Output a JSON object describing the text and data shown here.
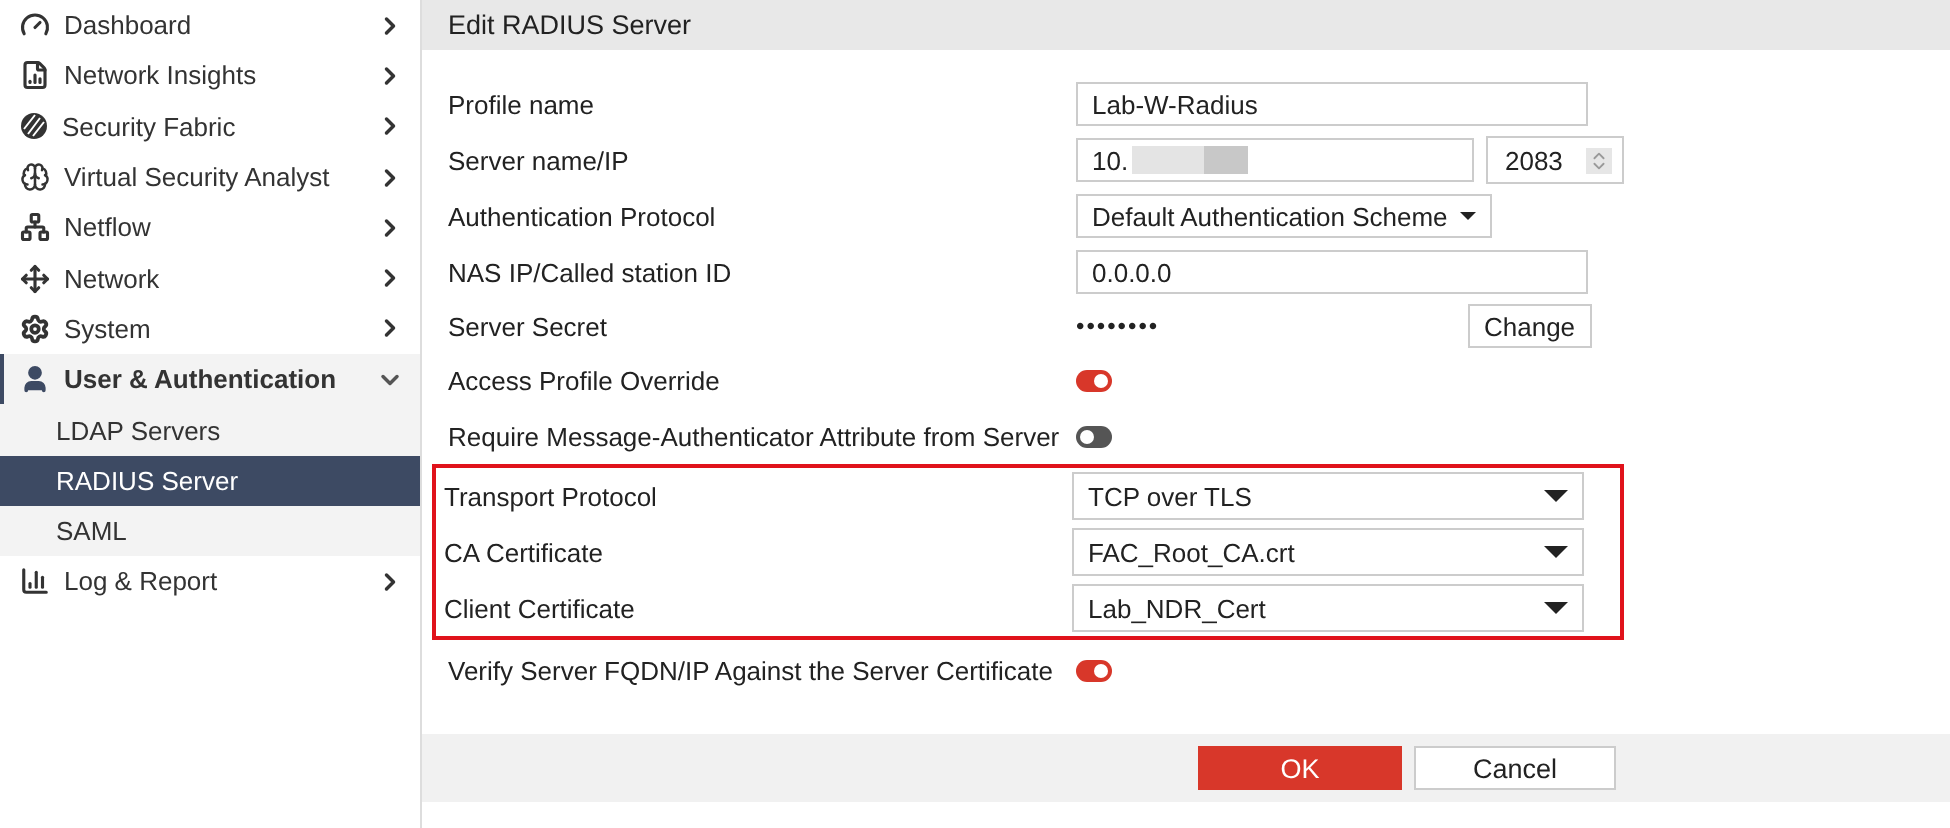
{
  "sidebar": {
    "items": [
      {
        "label": "Dashboard",
        "expanded": false
      },
      {
        "label": "Network Insights",
        "expanded": false
      },
      {
        "label": "Security Fabric",
        "expanded": false
      },
      {
        "label": "Virtual Security Analyst",
        "expanded": false
      },
      {
        "label": "Netflow",
        "expanded": false
      },
      {
        "label": "Network",
        "expanded": false
      },
      {
        "label": "System",
        "expanded": false
      },
      {
        "label": "User & Authentication",
        "expanded": true,
        "children": [
          {
            "label": "LDAP Servers",
            "selected": false
          },
          {
            "label": "RADIUS Server",
            "selected": true
          },
          {
            "label": "SAML",
            "selected": false
          }
        ]
      },
      {
        "label": "Log & Report",
        "expanded": false
      }
    ]
  },
  "panel": {
    "title": "Edit RADIUS Server",
    "sections": [
      {
        "highlighted": false,
        "rows": [
          {
            "kind": "text",
            "label": "Profile name",
            "value": "Lab-W-Radius"
          },
          {
            "kind": "address",
            "label": "Server name/IP",
            "value": "10.",
            "port": "2083"
          },
          {
            "kind": "menu",
            "label": "Authentication Protocol",
            "value": "Default Authentication Scheme"
          },
          {
            "kind": "text",
            "label": "NAS IP/Called station ID",
            "value": "0.0.0.0"
          },
          {
            "kind": "secret",
            "label": "Server Secret",
            "value": "••••••••",
            "button": "Change"
          },
          {
            "kind": "toggle",
            "label": "Access Profile Override",
            "on": true
          },
          {
            "kind": "toggle",
            "label": "Require Message-Authenticator Attribute from Server",
            "on": false
          }
        ]
      },
      {
        "highlighted": true,
        "rows": [
          {
            "kind": "select",
            "label": "Transport Protocol",
            "value": "TCP over TLS"
          },
          {
            "kind": "select",
            "label": "CA Certificate",
            "value": "FAC_Root_CA.crt"
          },
          {
            "kind": "select",
            "label": "Client Certificate",
            "value": "Lab_NDR_Cert"
          }
        ]
      },
      {
        "highlighted": false,
        "rows": [
          {
            "kind": "toggle",
            "label": "Verify Server FQDN/IP Against the Server Certificate",
            "on": true
          }
        ]
      }
    ],
    "buttons": [
      {
        "label": "OK",
        "primary": true
      },
      {
        "label": "Cancel",
        "primary": false
      }
    ]
  }
}
